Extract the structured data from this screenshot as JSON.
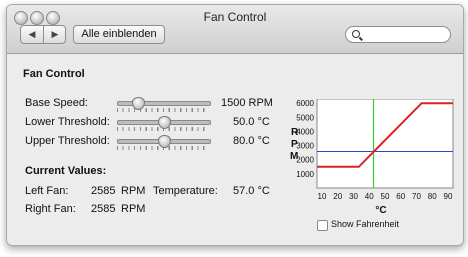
{
  "window": {
    "title": "Fan Control"
  },
  "toolbar": {
    "back_icon": "◀",
    "forward_icon": "▶",
    "show_all_label": "Alle einblenden",
    "search_placeholder": ""
  },
  "pane": {
    "heading": "Fan Control",
    "base_speed": {
      "label": "Base Speed:",
      "value": "1500 RPM",
      "slider_fraction": 0.22
    },
    "lower_threshold": {
      "label": "Lower Threshold:",
      "value": "50.0 °C",
      "slider_fraction": 0.5
    },
    "upper_threshold": {
      "label": "Upper Threshold:",
      "value": "80.0 °C",
      "slider_fraction": 0.5
    },
    "current_values_heading": "Current Values:",
    "left_fan": {
      "label": "Left Fan:",
      "value": "2585",
      "unit": "RPM"
    },
    "right_fan": {
      "label": "Right Fan:",
      "value": "2585",
      "unit": "RPM"
    },
    "temperature": {
      "label": "Temperature:",
      "value": "57.0 °C"
    },
    "show_fahrenheit_label": "Show Fahrenheit",
    "show_fahrenheit_checked": false
  },
  "chart_data": {
    "type": "line",
    "ylabel": "R P M",
    "xlabel": "°C",
    "xlim": [
      30,
      95
    ],
    "ylim": [
      0,
      6300
    ],
    "x_ticks": [
      "10",
      "20",
      "30",
      "40",
      "50",
      "60",
      "70",
      "80",
      "90"
    ],
    "y_ticks": [
      "1000",
      "2000",
      "3000",
      "4000",
      "5000",
      "6000"
    ],
    "fan_curve": {
      "x": [
        30,
        50,
        80,
        95
      ],
      "y": [
        1500,
        1500,
        6000,
        6000
      ],
      "color": "#e02020"
    },
    "current_temperature": {
      "x": 57.0,
      "color": "#33cc33"
    },
    "current_rpm": {
      "y": 2585,
      "color": "#3344cc"
    }
  }
}
